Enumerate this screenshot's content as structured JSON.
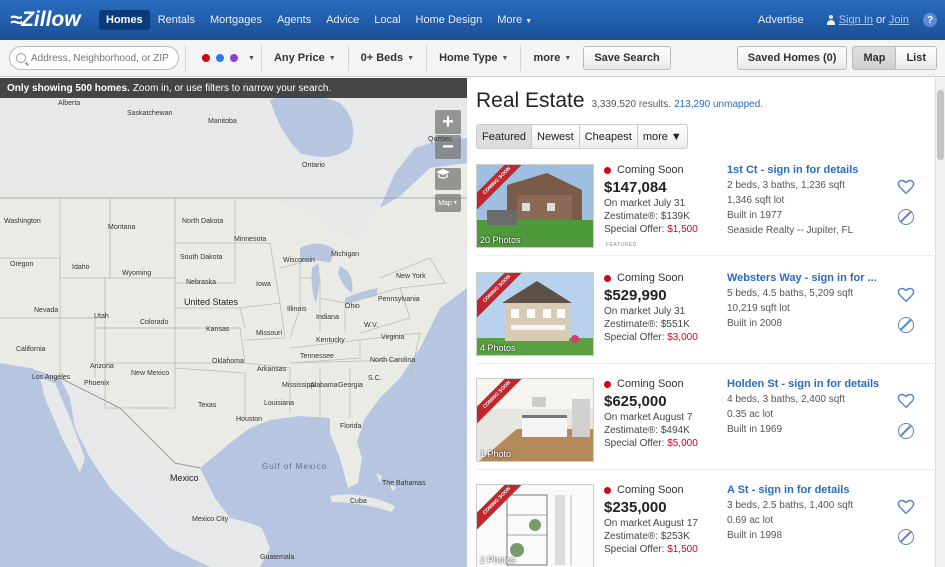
{
  "nav": {
    "logo_text": "Zillow",
    "links": [
      {
        "label": "Homes",
        "active": true
      },
      {
        "label": "Rentals"
      },
      {
        "label": "Mortgages"
      },
      {
        "label": "Agents"
      },
      {
        "label": "Advice"
      },
      {
        "label": "Local"
      },
      {
        "label": "Home Design"
      },
      {
        "label": "More",
        "caret": "▼"
      }
    ],
    "advertise": "Advertise",
    "sign_in": "Sign In",
    "or": "or",
    "join": "Join",
    "help": "?"
  },
  "filters": {
    "search_placeholder": "Address, Neighborhood, or ZIP",
    "dot_colors": [
      "#d0021b",
      "#2a7de1",
      "#8a3fd1"
    ],
    "caret": "▼",
    "price": "Any Price",
    "beds": "0+ Beds",
    "home_type": "Home Type",
    "more": "more",
    "save_search": "Save Search",
    "saved_homes": "Saved Homes (0)",
    "map": "Map",
    "list": "List"
  },
  "map": {
    "banner_bold": "Only showing 500 homes.",
    "banner_text": "Zoom in, or use filters to narrow your search.",
    "zoom_in": "+",
    "zoom_out": "−",
    "map_type": "Map",
    "labels": {
      "alberta": "Alberta",
      "saskatchewan": "Saskatchewan",
      "manitoba": "Manitoba",
      "ontario": "Ontario",
      "quebec": "Quebec",
      "washington": "Washington",
      "montana": "Montana",
      "north_dakota": "North Dakota",
      "minnesota": "Minnesota",
      "oregon": "Oregon",
      "idaho": "Idaho",
      "wyoming": "Wyoming",
      "south_dakota": "South Dakota",
      "wisconsin": "Wisconsin",
      "michigan": "Michigan",
      "nebraska": "Nebraska",
      "iowa": "Iowa",
      "united_states": "United States",
      "nevada": "Nevada",
      "utah": "Utah",
      "colorado": "Colorado",
      "illinois": "Illinois",
      "indiana": "Indiana",
      "ohio": "Ohio",
      "pennsylvania": "Pennsylvania",
      "new_york": "New York",
      "kansas": "Kansas",
      "missouri": "Missouri",
      "kentucky": "Kentucky",
      "west_virginia": "W.V.",
      "virginia": "Virginia",
      "california": "California",
      "arizona": "Arizona",
      "new_mexico": "New Mexico",
      "oklahoma": "Oklahoma",
      "tennessee": "Tennessee",
      "north_carolina": "North Carolina",
      "arkansas": "Arkansas",
      "south_carolina": "S.C.",
      "los_angeles": "Los Angeles",
      "phoenix": "Phoenix",
      "texas": "Texas",
      "mississippi": "Mississippi",
      "alabama": "Alabama",
      "georgia": "Georgia",
      "louisiana": "Louisiana",
      "houston": "Houston",
      "florida": "Florida",
      "gulf_of_mexico": "Gulf of Mexico",
      "mexico": "Mexico",
      "the_bahamas": "The Bahamas",
      "cuba": "Cuba",
      "mexico_city": "Mexico City",
      "guatemala": "Guatemala"
    }
  },
  "results": {
    "title": "Real Estate",
    "count": "3,339,520 results.",
    "unmapped": "213,290 unmapped.",
    "sort_tabs": [
      "Featured",
      "Newest",
      "Cheapest",
      "more ▼"
    ],
    "ribbon": "COMING SOON",
    "featured_label": "FEATURED",
    "listings": [
      {
        "status": "Coming Soon",
        "price": "$147,084",
        "market": "On market July 31",
        "zestimate_label": "Zestimate®:",
        "zestimate": "$139K",
        "offer_label": "Special Offer:",
        "offer": "$1,500",
        "photos": "20 Photos",
        "address": "1st Ct - sign in for details",
        "details": [
          "2 beds, 3 baths, 1,236 sqft",
          "1,346 sqft lot",
          "Built in 1977",
          "Seaside Realty -- Jupiter, FL"
        ]
      },
      {
        "status": "Coming Soon",
        "price": "$529,990",
        "market": "On market July 31",
        "zestimate_label": "Zestimate®:",
        "zestimate": "$551K",
        "offer_label": "Special Offer:",
        "offer": "$3,000",
        "photos": "4 Photos",
        "address": "Websters Way - sign in for ...",
        "details": [
          "5 beds, 4.5 baths, 5,209 sqft",
          "10,219 sqft lot",
          "Built in 2008"
        ]
      },
      {
        "status": "Coming Soon",
        "price": "$625,000",
        "market": "On market August 7",
        "zestimate_label": "Zestimate®:",
        "zestimate": "$494K",
        "offer_label": "Special Offer:",
        "offer": "$5,000",
        "photos": "1 Photo",
        "address": "Holden St - sign in for details",
        "details": [
          "4 beds, 3 baths, 2,400 sqft",
          "0.35 ac lot",
          "Built in 1969"
        ]
      },
      {
        "status": "Coming Soon",
        "price": "$235,000",
        "market": "On market August 17",
        "zestimate_label": "Zestimate®:",
        "zestimate": "$253K",
        "offer_label": "Special Offer:",
        "offer": "$1,500",
        "photos": "2 Photos",
        "address": "A St - sign in for details",
        "details": [
          "3 beds, 2.5 baths, 1,400 sqft",
          "0.69 ac lot",
          "Built in 1998"
        ]
      }
    ]
  }
}
